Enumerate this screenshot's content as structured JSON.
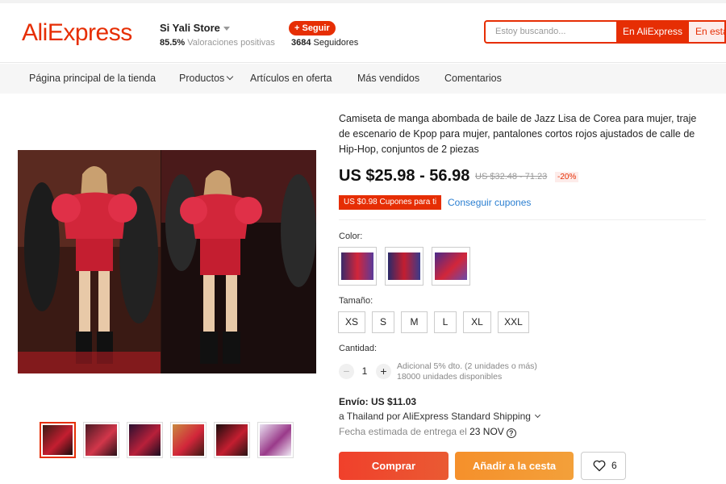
{
  "header": {
    "logo": "AliExpress",
    "store_name": "Si Yali Store",
    "rating_percent": "85.5%",
    "rating_label": "Valoraciones positivas",
    "follow_label": "+ Seguir",
    "followers_count": "3684",
    "followers_label": "Seguidores",
    "search_placeholder": "Estoy buscando...",
    "search_ali_label": "En AliExpress",
    "search_store_label": "En esta tienda"
  },
  "nav": {
    "items": [
      "Página principal de la tienda",
      "Productos",
      "Artículos en oferta",
      "Más vendidos",
      "Comentarios"
    ]
  },
  "product": {
    "title": "Camiseta de manga abombada de baile de Jazz Lisa de Corea para mujer, traje de escenario de Kpop para mujer, pantalones cortos rojos ajustados de calle de Hip-Hop, conjuntos de 2 piezas",
    "price": "US $25.98 - 56.98",
    "price_old": "US $32.48 - 71.23",
    "discount": "-20%",
    "coupon": "US $0.98 Cupones para ti",
    "coupon_link": "Conseguir cupones",
    "color_label": "Color:",
    "size_label": "Tamaño:",
    "sizes": [
      "XS",
      "S",
      "M",
      "L",
      "XL",
      "XXL"
    ],
    "quantity_label": "Cantidad:",
    "quantity": "1",
    "qty_minus": "−",
    "qty_plus": "+",
    "quantity_note_1": "Adicional 5% dto. (2 unidades o más)",
    "quantity_note_2": "18000 unidades disponibles",
    "shipping": "Envío: US $11.03",
    "ship_to": "a Thailand por AliExpress Standard Shipping",
    "delivery_prefix": "Fecha estimada de entrega el",
    "delivery_date": "23 NOV",
    "buy_label": "Comprar",
    "cart_label": "Añadir a la cesta",
    "wish_count": "6"
  },
  "colors": {
    "brand": "#e62e04",
    "link": "#2b7fd1",
    "buy": "#f0402b",
    "cart": "#f5902b"
  }
}
